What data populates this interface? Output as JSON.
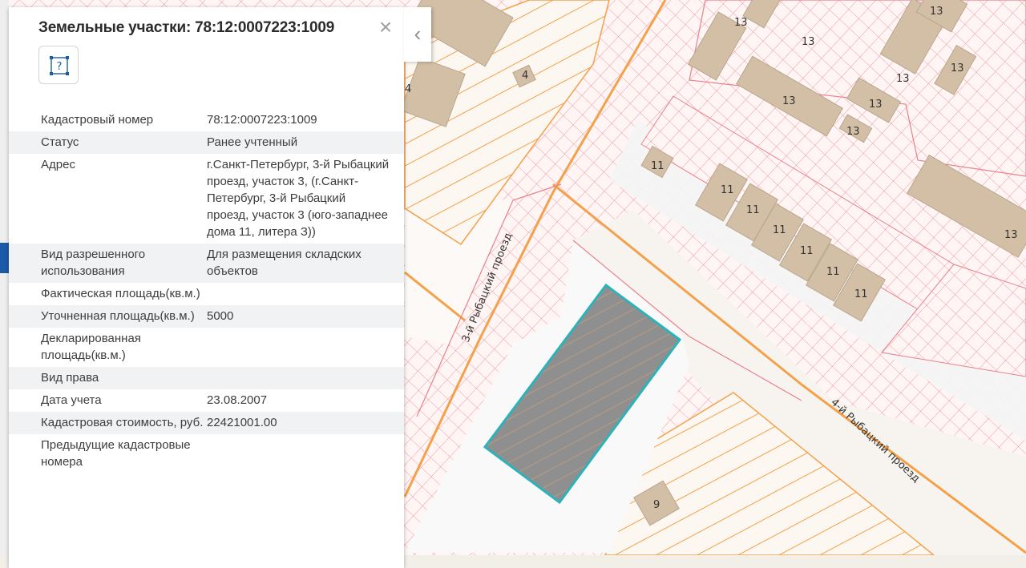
{
  "panel": {
    "title": "Земельные участки: 78:12:0007223:1009",
    "close_glyph": "×",
    "collapse_glyph": "‹",
    "help_icon": "help-icon",
    "attributes": [
      {
        "key": "Кадастровый номер",
        "value": "78:12:0007223:1009"
      },
      {
        "key": "Статус",
        "value": "Ранее учтенный"
      },
      {
        "key": "Адрес",
        "value": "г.Санкт-Петербург, 3-й Рыбацкий проезд, участок 3, (г.Санкт-Петербург, 3-й Рыбацкий проезд, участок 3 (юго-западнее дома 11, литера З))"
      },
      {
        "key": "Вид разрешенного использования",
        "value": "Для размещения складских объектов"
      },
      {
        "key": "Фактическая площадь(кв.м.)",
        "value": ""
      },
      {
        "key": "Уточненная площадь(кв.м.)",
        "value": "5000"
      },
      {
        "key": "Декларированная площадь(кв.м.)",
        "value": ""
      },
      {
        "key": "Вид права",
        "value": ""
      },
      {
        "key": "Дата учета",
        "value": "23.08.2007"
      },
      {
        "key": "Кадастровая стоимость, руб.",
        "value": "22421001.00"
      },
      {
        "key": "Предыдущие кадастровые номера",
        "value": ""
      }
    ]
  },
  "map": {
    "street_labels": {
      "street_3": "3-й Рыбацкий проезд",
      "street_4": "4-й Рыбацкий проезд"
    },
    "building_numbers": {
      "n13": "13",
      "n11": "11",
      "n9": "9",
      "n4": "4"
    },
    "colors": {
      "parcel_hatch": "#e9818a",
      "road_line": "#f3a14a",
      "building_fill": "#d2bfa6",
      "selected_outline": "#2bb3b9",
      "selected_fill": "#8f8f8f"
    }
  }
}
